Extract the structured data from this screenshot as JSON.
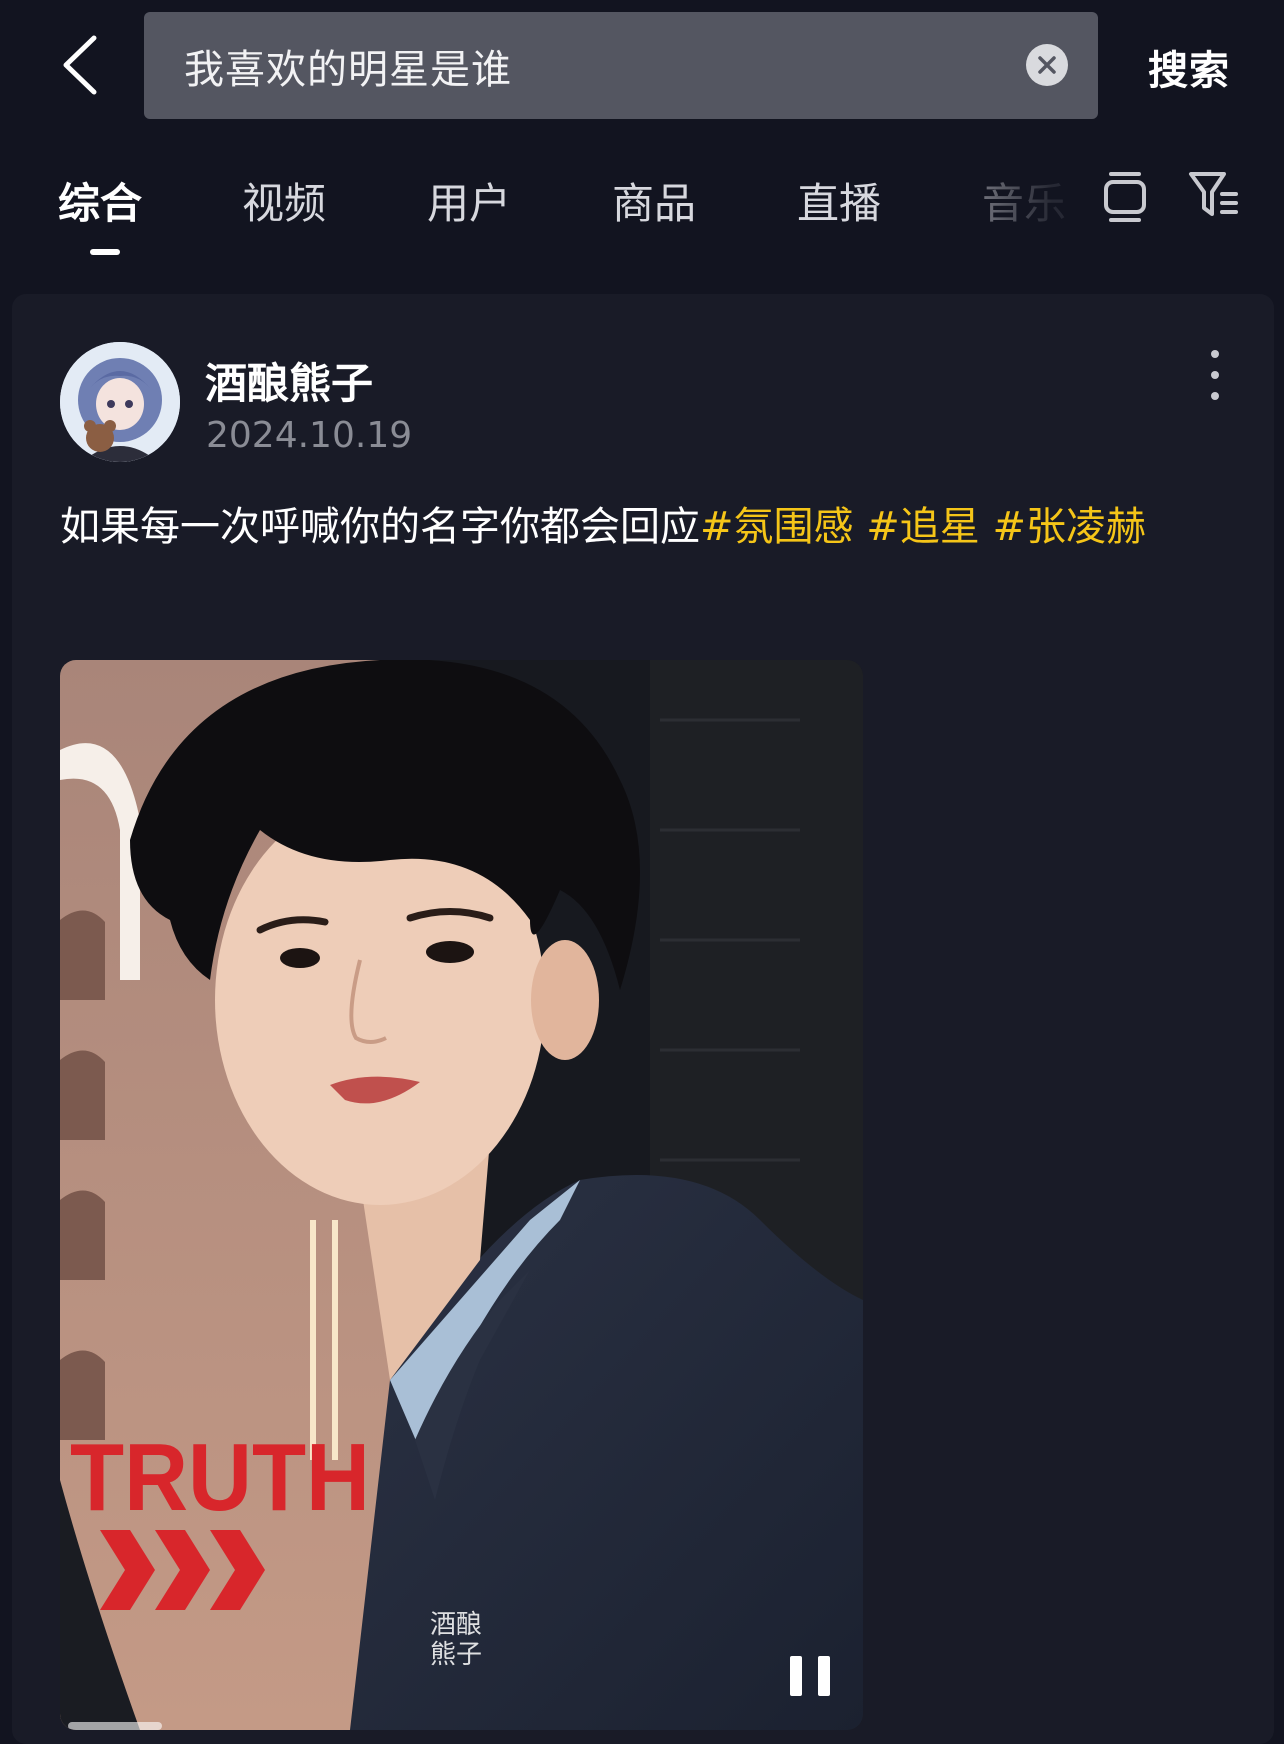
{
  "search": {
    "query": "我喜欢的明星是谁",
    "submit_label": "搜索"
  },
  "tabs": [
    {
      "label": "综合",
      "active": true
    },
    {
      "label": "视频",
      "active": false
    },
    {
      "label": "用户",
      "active": false
    },
    {
      "label": "商品",
      "active": false
    },
    {
      "label": "直播",
      "active": false
    },
    {
      "label": "音乐",
      "active": false
    }
  ],
  "toolbar_icons": [
    "back-icon",
    "clear-icon",
    "layout-toggle-icon",
    "filter-icon"
  ],
  "post": {
    "author": "酒酿熊子",
    "date": "2024.10.19",
    "caption": "如果每一次呼喊你的名字你都会回应",
    "hashtags": [
      "#氛围感",
      "#追星",
      "#张凌赫"
    ],
    "video": {
      "sign_text": "TRUTH",
      "watermark_line1": "酒酿",
      "watermark_line2": "熊子",
      "playing": true,
      "progress": 0.12
    }
  },
  "colors": {
    "background": "#121420",
    "card": "#191b27",
    "hashtag": "#f5c518",
    "search_box": "#545661"
  }
}
